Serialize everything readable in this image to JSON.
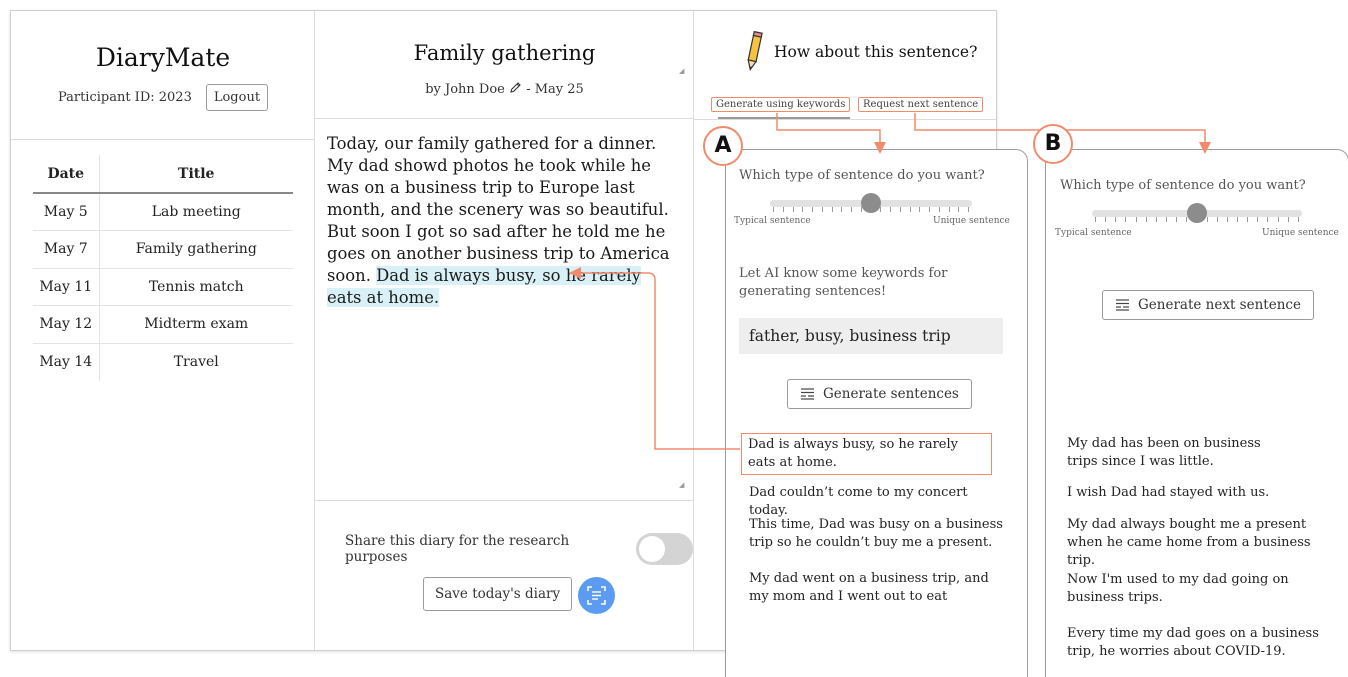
{
  "left": {
    "brand": "DiaryMate",
    "participant_label": "Participant ID: 2023",
    "logout_label": "Logout",
    "table_headers": {
      "date": "Date",
      "title": "Title"
    },
    "entries": [
      {
        "date": "May 5",
        "title": "Lab meeting"
      },
      {
        "date": "May 7",
        "title": "Family gathering"
      },
      {
        "date": "May 11",
        "title": "Tennis match"
      },
      {
        "date": "May 12",
        "title": "Midterm exam"
      },
      {
        "date": "May 14",
        "title": "Travel"
      }
    ]
  },
  "middle": {
    "title": "Family gathering",
    "byline_author": "by John Doe",
    "byline_date": "- May 25",
    "body_plain": "Today, our family gathered for a dinner. My dad showd photos he took while he was on a business trip to Europe last month, and the scenery was so beautiful. But soon I got so sad after he told me he goes on another business trip to America soon. ",
    "body_highlight": "Dad is always busy, so he rarely eats at home.",
    "share_label": "Share this diary for the research purposes",
    "share_enabled": false,
    "save_label": "Save today's diary"
  },
  "right": {
    "prompt": "How about this sentence?",
    "tab_keywords": "Generate using keywords",
    "tab_next": "Request next sentence"
  },
  "panel_a": {
    "marker": "A",
    "question": "Which type of sentence do you want?",
    "slider_min_label": "Typical sentence",
    "slider_max_label": "Unique sentence",
    "slider_value": 0.5,
    "keyword_label": "Let AI know some keywords for generating sentences!",
    "keyword_value": "father, busy, business trip",
    "generate_label": "Generate sentences",
    "suggestions": [
      "Dad is always busy, so he rarely eats at home.",
      "Dad couldn’t come to my concert today.",
      "This time, Dad was busy on a business trip so he couldn’t buy me a present.",
      "My dad went on a business trip, and my mom and I went out to eat"
    ]
  },
  "panel_b": {
    "marker": "B",
    "question": "Which type of sentence do you want?",
    "slider_min_label": "Typical sentence",
    "slider_max_label": "Unique sentence",
    "slider_value": 0.5,
    "generate_label": "Generate next sentence",
    "suggestions": [
      "My dad has been on business trips since I was little.",
      "I wish Dad had stayed with us.",
      "My dad always bought me a present when he came home from a business trip.",
      "Now I'm used to my dad going on business trips.",
      "Every time my dad goes on a business trip, he worries about COVID-19."
    ]
  },
  "colors": {
    "accent": "#f08c6c",
    "highlight": "#d9f1f6",
    "fab": "#5b9cf2",
    "toggle_off": "#d4d4d4"
  }
}
